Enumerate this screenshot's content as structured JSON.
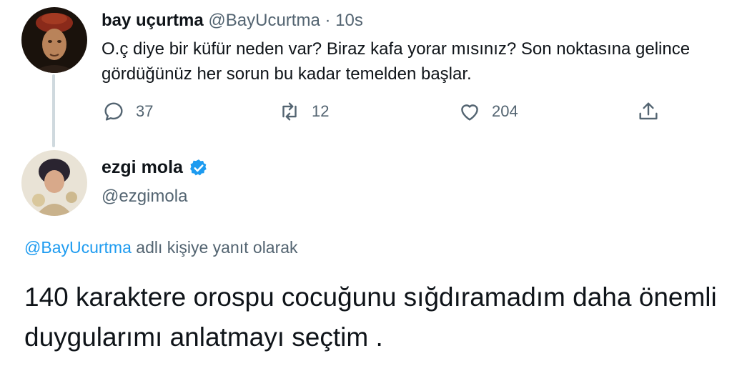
{
  "tweet1": {
    "name": "bay uçurtma",
    "handle": "@BayUcurtma",
    "separator": "·",
    "time": "10s",
    "text": "O.ç diye bir küfür neden var? Biraz kafa yorar mısınız? Son noktasına gelince gördüğünüz her sorun bu kadar temelden başlar.",
    "actions": {
      "reply_count": "37",
      "retweet_count": "12",
      "like_count": "204"
    },
    "icons": {
      "reply": "reply-icon",
      "retweet": "retweet-icon",
      "like": "heart-icon",
      "share": "share-icon"
    }
  },
  "tweet2": {
    "name": "ezgi mola",
    "handle": "@ezgimola",
    "verified": true,
    "replying_mention": "@BayUcurtma",
    "replying_suffix": "adlı kişiye yanıt olarak",
    "text": "140 karaktere orospu cocuğunu sığdıramadım daha önemli duygularımı anlatmayı seçtim ."
  },
  "colors": {
    "text_primary": "#0f1419",
    "text_secondary": "#536471",
    "accent": "#1d9bf0",
    "thread_line": "#cfd9de"
  }
}
